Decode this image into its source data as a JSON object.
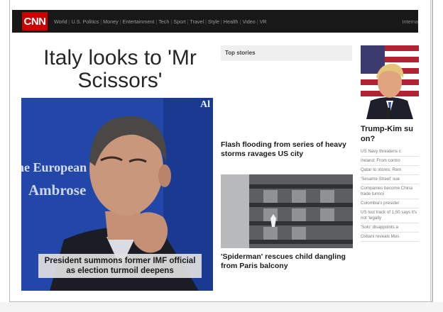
{
  "nav": {
    "logo": "CNN",
    "links": [
      "World",
      "U.S. Politics",
      "Money",
      "Entertainment",
      "Tech",
      "Sport",
      "Travel",
      "Style",
      "Health",
      "Video",
      "VR"
    ],
    "right": "Interna"
  },
  "headline": "Italy looks to 'Mr Scissors'",
  "hero": {
    "bg_text_1": "he European",
    "bg_text_2": "Ambrose",
    "bg_text_3": "Al",
    "caption": "President summons former IMF official as election turmoil deepens"
  },
  "top_stories": {
    "header": "Top stories",
    "story1": "Flash flooding from series of heavy storms ravages US city",
    "story2": "'Spiderman' rescues child dangling from Paris balcony"
  },
  "right_column": {
    "headline": "Trump-Kim su on?",
    "items": [
      "US Navy threatens c",
      "Ireland: From contro",
      "Qatar to stores: Rem",
      "'Sesame Street' sue",
      "Companies become China trade turmoi",
      "Colombia's presider",
      "US lost track of 1,50 says it's not 'legally",
      "'Solo' disappoints a",
      "Oxitani reveals Mus"
    ]
  },
  "colors": {
    "nav_bg": "#181818",
    "logo_red": "#cc0000",
    "hero_blue": "#2446a6"
  }
}
